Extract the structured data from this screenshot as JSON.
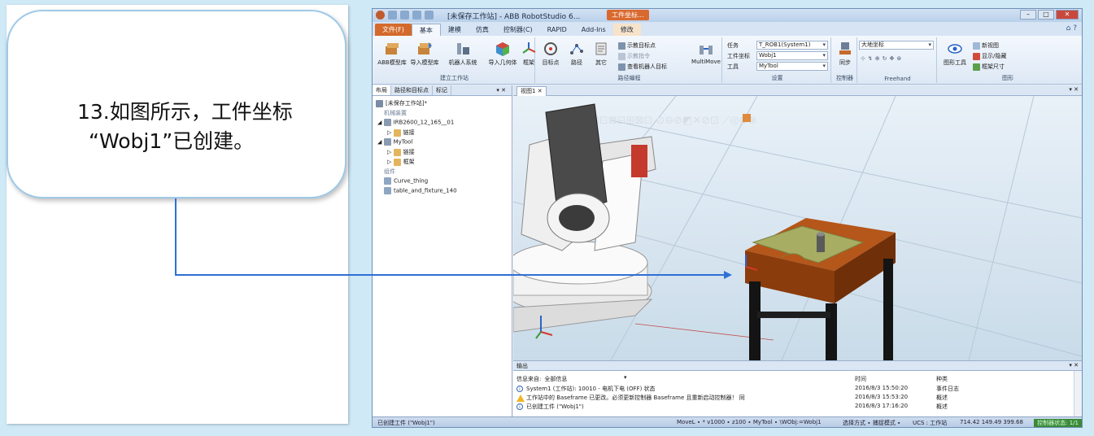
{
  "callout": {
    "line1": "13.如图所示，工件坐标",
    "line2": "“Wobj1”已创建。"
  },
  "app": {
    "title": "[未保存工作站] - ABB RobotStudio 6...",
    "context_tab_label": "工件坐标...",
    "tabs": [
      "文件(F)",
      "基本",
      "建模",
      "仿真",
      "控制器(C)",
      "RAPID",
      "Add-Ins",
      "修改"
    ],
    "ribbon": {
      "build_group": {
        "label": "建立工作站",
        "buttons": [
          "ABB模型库",
          "导入模型库",
          "机器人系统",
          "导入几何体",
          "框架"
        ]
      },
      "path_group": {
        "label": "路径编程",
        "buttons": [
          "目标点",
          "路径",
          "其它"
        ],
        "small": [
          "示教目标点",
          "示教指令",
          "查看机器人目标"
        ],
        "multimove": "MultiMove"
      },
      "settings_group": {
        "label": "设置",
        "labels": [
          "任务",
          "工件坐标",
          "工具"
        ],
        "task_value": "T_ROB1(System1)",
        "wobj_value": "Wobj1",
        "tool_value": "MyTool"
      },
      "controller_group": {
        "label": "控制器",
        "button": "同步"
      },
      "freehand_group": {
        "label": "Freehand",
        "frame_value": "大地坐标"
      },
      "graphics_group": {
        "label": "图形",
        "button": "图形工具",
        "small": [
          "新视图",
          "显示/隐藏",
          "框架尺寸"
        ]
      }
    },
    "tree": {
      "tabs": [
        "布局",
        "路径和目标点",
        "标记"
      ],
      "nodes": [
        "[未保存工作站]*",
        "机械装置",
        "IRB2600_12_165__01",
        "链接",
        "MyTool",
        "链接",
        "框架",
        "组件",
        "Curve_thing",
        "table_and_fixture_140"
      ]
    },
    "view_tab": "视图1",
    "output": {
      "title": "输出",
      "filter_label": "信息来自:",
      "filter_value": "全部信息",
      "col_time": "时间",
      "col_category": "种类",
      "rows": [
        {
          "icon": "info-icon",
          "message": "System1 (工作站): 10010 - 电机下电 (OFF) 状态",
          "time": "2016/8/3 15:50:20",
          "category": "事件日志"
        },
        {
          "icon": "warning-icon",
          "message": "工作站中的 Baseframe 已更改。必须更新控制器 Baseframe 且重新启动控制器！ 同",
          "time": "2016/8/3 15:53:20",
          "category": "概述"
        },
        {
          "icon": "info-icon",
          "message": "已创建工件 (\"Wobj1\")",
          "time": "2016/8/3 17:16:20",
          "category": "概述"
        }
      ]
    },
    "status": {
      "left": "已创建工件 (\"Wobj1\")",
      "mode": "MoveL ∙ * v1000 ∙ z100 ∙ MyTool ∙ \\WObj:=Wobj1",
      "select": "选择方式 ∙ 捕捉模式 ∙",
      "ucs": "UCS : 工作站",
      "coords": "714.42 149.49 399.68",
      "controller": "控制器状态: 1/1"
    }
  },
  "colors": {
    "pointer_line": "#2f6fd6",
    "table_top": "#9e4a0e",
    "workobject_plate": "#a7ad62",
    "robot_body": "#f1f1f1"
  }
}
